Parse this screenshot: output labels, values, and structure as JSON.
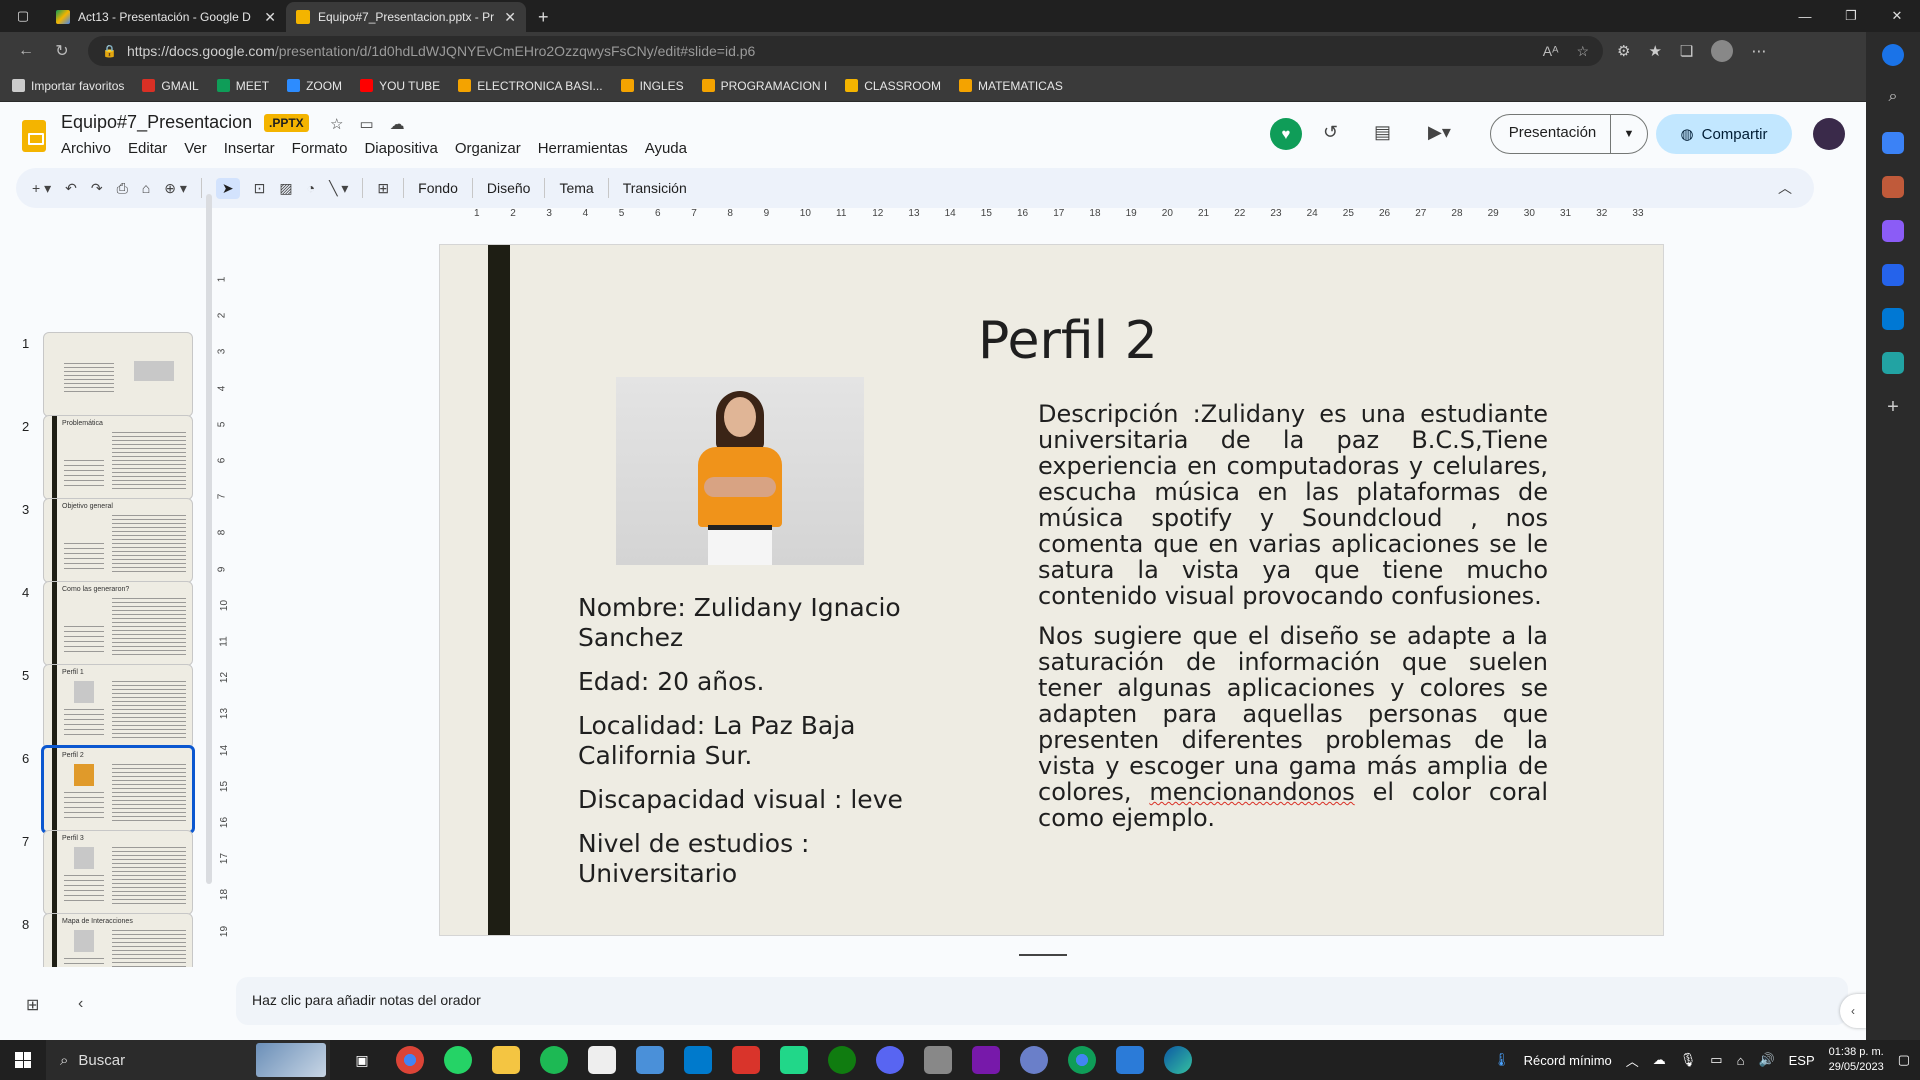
{
  "browser": {
    "tabs": [
      {
        "title": "Act13 - Presentación - Google D",
        "active": false,
        "color": "#f4b400"
      },
      {
        "title": "Equipo#7_Presentacion.pptx - Pr",
        "active": true,
        "color": "#f4b400"
      }
    ],
    "url_host": "https://docs.google.com",
    "url_path": "/presentation/d/1d0hdLdWJQNYEvCmEHro2OzzqwysFsCNy/edit#slide=id.p6",
    "bookmarks": [
      {
        "label": "Importar favoritos",
        "color": "#cccccc"
      },
      {
        "label": "GMAIL",
        "color": "#d93025"
      },
      {
        "label": "MEET",
        "color": "#0f9d58"
      },
      {
        "label": "ZOOM",
        "color": "#2d8cff"
      },
      {
        "label": "YOU TUBE",
        "color": "#ff0000"
      },
      {
        "label": "ELECTRONICA BASI...",
        "color": "#f4a300"
      },
      {
        "label": "INGLES",
        "color": "#f4a300"
      },
      {
        "label": "PROGRAMACION I",
        "color": "#f4a300"
      },
      {
        "label": "CLASSROOM",
        "color": "#f4b400"
      },
      {
        "label": "MATEMATICAS",
        "color": "#f4a300"
      }
    ]
  },
  "docs": {
    "title": "Equipo#7_Presentacion",
    "badge": ".PPTX",
    "menu": [
      "Archivo",
      "Editar",
      "Ver",
      "Insertar",
      "Formato",
      "Diapositiva",
      "Organizar",
      "Herramientas",
      "Ayuda"
    ],
    "present_label": "Presentación",
    "share_label": "Compartir",
    "toolbar_text_buttons": [
      "Fondo",
      "Diseño",
      "Tema",
      "Transición"
    ],
    "notes_placeholder": "Haz clic para añadir notas del orador",
    "ruler_h": [
      "1",
      "2",
      "3",
      "4",
      "5",
      "6",
      "7",
      "8",
      "9",
      "10",
      "11",
      "12",
      "13",
      "14",
      "15",
      "16",
      "17",
      "18",
      "19",
      "20",
      "21",
      "22",
      "23",
      "24",
      "25",
      "26",
      "27",
      "28",
      "29",
      "30",
      "31",
      "32",
      "33"
    ],
    "ruler_v": [
      "1",
      "2",
      "3",
      "4",
      "5",
      "6",
      "7",
      "8",
      "9",
      "10",
      "11",
      "12",
      "13",
      "14",
      "15",
      "16",
      "17",
      "18",
      "19"
    ]
  },
  "filmstrip": [
    {
      "num": "1",
      "title": "",
      "selected": false
    },
    {
      "num": "2",
      "title": "Problemática",
      "selected": false
    },
    {
      "num": "3",
      "title": "Objetivo general",
      "selected": false
    },
    {
      "num": "4",
      "title": "Como las generaron?",
      "selected": false
    },
    {
      "num": "5",
      "title": "Perfil 1",
      "selected": false
    },
    {
      "num": "6",
      "title": "Perfil 2",
      "selected": true
    },
    {
      "num": "7",
      "title": "Perfil 3",
      "selected": false
    },
    {
      "num": "8",
      "title": "Mapa de Interacciones",
      "selected": false
    }
  ],
  "slide": {
    "title": "Perfil 2",
    "info": [
      "Nombre: Zulidany Ignacio Sanchez",
      "Edad: 20 años.",
      "Localidad: La Paz Baja California Sur.",
      "Discapacidad visual : leve",
      "Nivel de estudios : Universitario"
    ],
    "desc1": "Descripción :Zulidany es una estudiante universitaria de la paz B.C.S,Tiene experiencia en computadoras y celulares, escucha música en las plataformas de música spotify y Soundcloud , nos comenta que en varias aplicaciones se le satura la vista ya que tiene mucho contenido visual provocando confusiones.",
    "desc2_a": "Nos sugiere que el diseño se adapte a la saturación de información que suelen tener algunas aplicaciones y colores se adapten para aquellas personas que presenten diferentes problemas de la vista y escoger una gama más amplia de colores, ",
    "desc2_b": "mencionandonos",
    "desc2_c": " el color coral como ejemplo."
  },
  "taskbar": {
    "search": "Buscar",
    "weather": "Récord mínimo",
    "lang": "ESP",
    "time": "01:38 p. m.",
    "date": "29/05/2023"
  }
}
